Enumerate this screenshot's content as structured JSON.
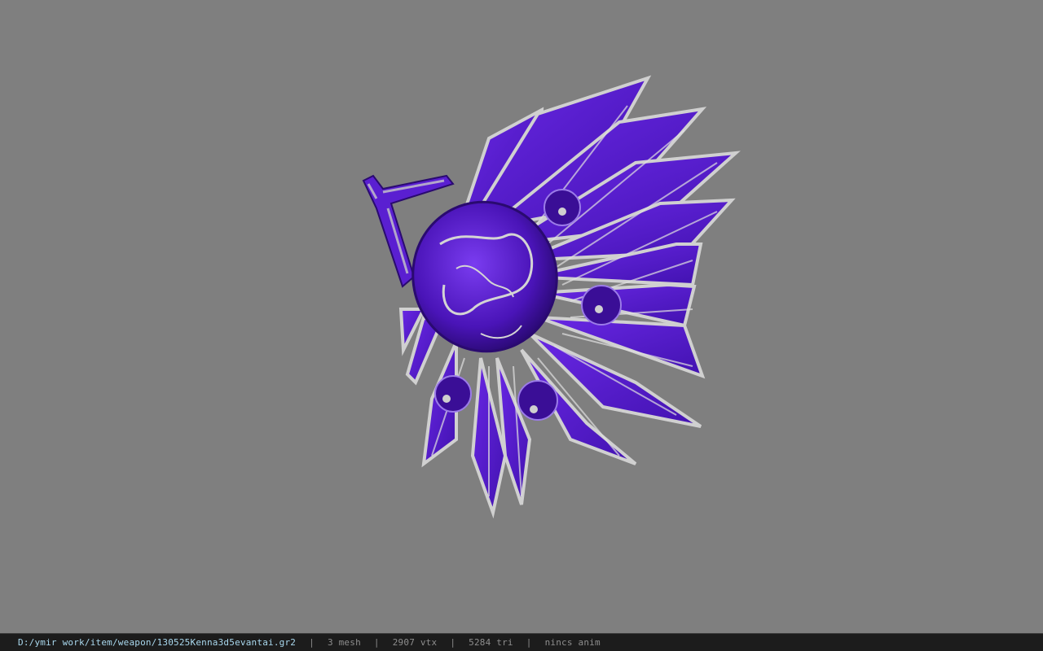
{
  "viewer": {
    "background_color": "#7f7f7f",
    "model": {
      "name": "weapon-fan-model",
      "primary_color": "#5a1fd1",
      "trim_color": "#c8c8c8"
    }
  },
  "status_bar": {
    "file_path": "D:/ymir work/item/weapon/130525Kenna3d5evantai.gr2",
    "separator": "|",
    "mesh_count": "3 mesh",
    "vertex_count": "2907 vtx",
    "triangle_count": "5284 tri",
    "anim_status": "nincs anim",
    "path_color": "#a9d8ee",
    "text_color": "#8e8e8e"
  }
}
